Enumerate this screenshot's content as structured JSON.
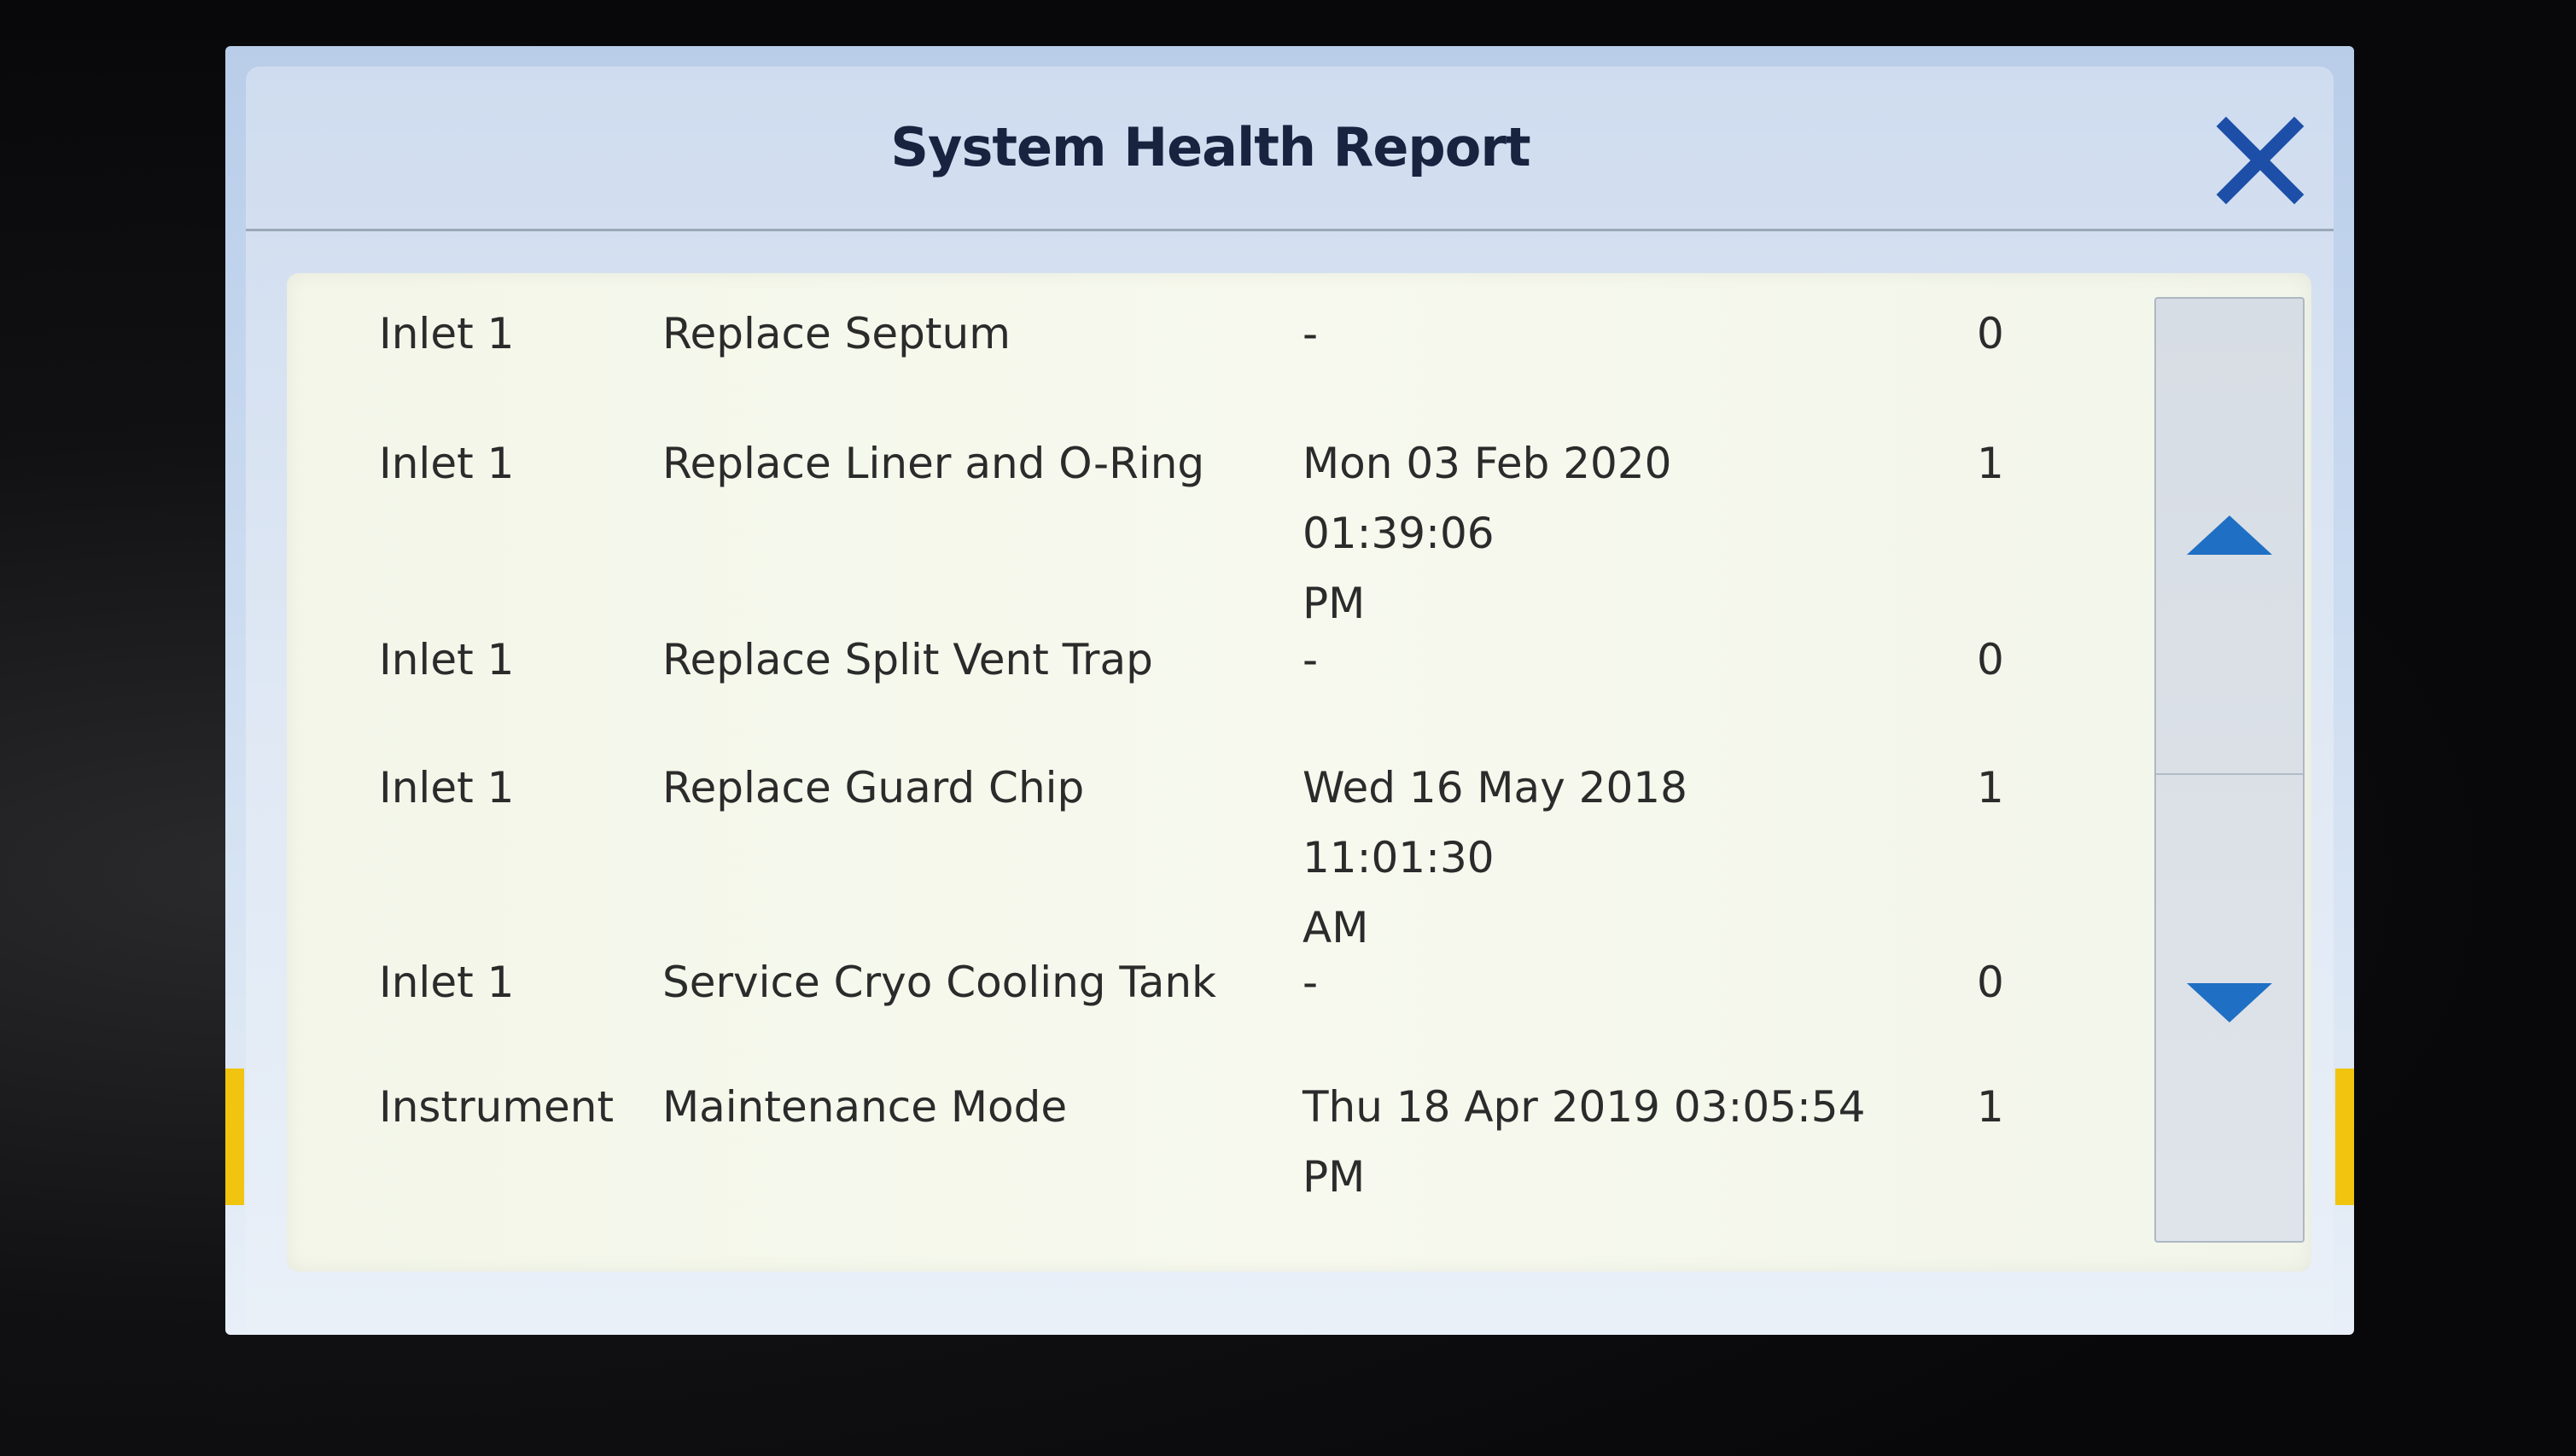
{
  "dialog": {
    "title": "System Health Report"
  },
  "rows": [
    {
      "location": "Inlet 1",
      "task": "Replace Septum",
      "date_line1": "-",
      "date_line2": "",
      "count": "0"
    },
    {
      "location": "Inlet 1",
      "task": "Replace Liner and O-Ring",
      "date_line1": "Mon 03 Feb 2020 01:39:06",
      "date_line2": "PM",
      "count": "1"
    },
    {
      "location": "Inlet 1",
      "task": "Replace Split Vent Trap",
      "date_line1": "-",
      "date_line2": "",
      "count": "0"
    },
    {
      "location": "Inlet 1",
      "task": "Replace Guard Chip",
      "date_line1": "Wed 16 May 2018 11:01:30",
      "date_line2": "AM",
      "count": "1"
    },
    {
      "location": "Inlet 1",
      "task": "Service Cryo Cooling Tank",
      "date_line1": "-",
      "date_line2": "",
      "count": "0"
    },
    {
      "location": "Instrument",
      "task": "Maintenance Mode",
      "date_line1": "Thu 18 Apr 2019 03:05:54",
      "date_line2": "PM",
      "count": "1"
    }
  ],
  "icons": {
    "close": "close-icon",
    "scroll_up": "triangle-up-icon",
    "scroll_down": "triangle-down-icon"
  },
  "colors": {
    "accent": "#1f6fc4",
    "close_icon": "#1d4fa8",
    "title_text": "#17233f",
    "content_bg": "#f5f8ec",
    "status_accent": "#f1c40f"
  }
}
